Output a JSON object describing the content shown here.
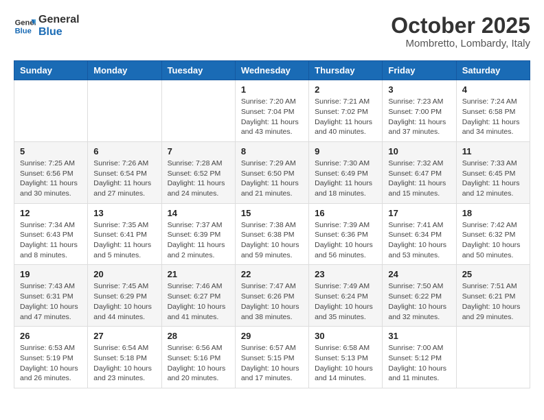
{
  "header": {
    "logo_line1": "General",
    "logo_line2": "Blue",
    "month": "October 2025",
    "location": "Mombretto, Lombardy, Italy"
  },
  "weekdays": [
    "Sunday",
    "Monday",
    "Tuesday",
    "Wednesday",
    "Thursday",
    "Friday",
    "Saturday"
  ],
  "weeks": [
    [
      {
        "day": "",
        "info": ""
      },
      {
        "day": "",
        "info": ""
      },
      {
        "day": "",
        "info": ""
      },
      {
        "day": "1",
        "info": "Sunrise: 7:20 AM\nSunset: 7:04 PM\nDaylight: 11 hours\nand 43 minutes."
      },
      {
        "day": "2",
        "info": "Sunrise: 7:21 AM\nSunset: 7:02 PM\nDaylight: 11 hours\nand 40 minutes."
      },
      {
        "day": "3",
        "info": "Sunrise: 7:23 AM\nSunset: 7:00 PM\nDaylight: 11 hours\nand 37 minutes."
      },
      {
        "day": "4",
        "info": "Sunrise: 7:24 AM\nSunset: 6:58 PM\nDaylight: 11 hours\nand 34 minutes."
      }
    ],
    [
      {
        "day": "5",
        "info": "Sunrise: 7:25 AM\nSunset: 6:56 PM\nDaylight: 11 hours\nand 30 minutes."
      },
      {
        "day": "6",
        "info": "Sunrise: 7:26 AM\nSunset: 6:54 PM\nDaylight: 11 hours\nand 27 minutes."
      },
      {
        "day": "7",
        "info": "Sunrise: 7:28 AM\nSunset: 6:52 PM\nDaylight: 11 hours\nand 24 minutes."
      },
      {
        "day": "8",
        "info": "Sunrise: 7:29 AM\nSunset: 6:50 PM\nDaylight: 11 hours\nand 21 minutes."
      },
      {
        "day": "9",
        "info": "Sunrise: 7:30 AM\nSunset: 6:49 PM\nDaylight: 11 hours\nand 18 minutes."
      },
      {
        "day": "10",
        "info": "Sunrise: 7:32 AM\nSunset: 6:47 PM\nDaylight: 11 hours\nand 15 minutes."
      },
      {
        "day": "11",
        "info": "Sunrise: 7:33 AM\nSunset: 6:45 PM\nDaylight: 11 hours\nand 12 minutes."
      }
    ],
    [
      {
        "day": "12",
        "info": "Sunrise: 7:34 AM\nSunset: 6:43 PM\nDaylight: 11 hours\nand 8 minutes."
      },
      {
        "day": "13",
        "info": "Sunrise: 7:35 AM\nSunset: 6:41 PM\nDaylight: 11 hours\nand 5 minutes."
      },
      {
        "day": "14",
        "info": "Sunrise: 7:37 AM\nSunset: 6:39 PM\nDaylight: 11 hours\nand 2 minutes."
      },
      {
        "day": "15",
        "info": "Sunrise: 7:38 AM\nSunset: 6:38 PM\nDaylight: 10 hours\nand 59 minutes."
      },
      {
        "day": "16",
        "info": "Sunrise: 7:39 AM\nSunset: 6:36 PM\nDaylight: 10 hours\nand 56 minutes."
      },
      {
        "day": "17",
        "info": "Sunrise: 7:41 AM\nSunset: 6:34 PM\nDaylight: 10 hours\nand 53 minutes."
      },
      {
        "day": "18",
        "info": "Sunrise: 7:42 AM\nSunset: 6:32 PM\nDaylight: 10 hours\nand 50 minutes."
      }
    ],
    [
      {
        "day": "19",
        "info": "Sunrise: 7:43 AM\nSunset: 6:31 PM\nDaylight: 10 hours\nand 47 minutes."
      },
      {
        "day": "20",
        "info": "Sunrise: 7:45 AM\nSunset: 6:29 PM\nDaylight: 10 hours\nand 44 minutes."
      },
      {
        "day": "21",
        "info": "Sunrise: 7:46 AM\nSunset: 6:27 PM\nDaylight: 10 hours\nand 41 minutes."
      },
      {
        "day": "22",
        "info": "Sunrise: 7:47 AM\nSunset: 6:26 PM\nDaylight: 10 hours\nand 38 minutes."
      },
      {
        "day": "23",
        "info": "Sunrise: 7:49 AM\nSunset: 6:24 PM\nDaylight: 10 hours\nand 35 minutes."
      },
      {
        "day": "24",
        "info": "Sunrise: 7:50 AM\nSunset: 6:22 PM\nDaylight: 10 hours\nand 32 minutes."
      },
      {
        "day": "25",
        "info": "Sunrise: 7:51 AM\nSunset: 6:21 PM\nDaylight: 10 hours\nand 29 minutes."
      }
    ],
    [
      {
        "day": "26",
        "info": "Sunrise: 6:53 AM\nSunset: 5:19 PM\nDaylight: 10 hours\nand 26 minutes."
      },
      {
        "day": "27",
        "info": "Sunrise: 6:54 AM\nSunset: 5:18 PM\nDaylight: 10 hours\nand 23 minutes."
      },
      {
        "day": "28",
        "info": "Sunrise: 6:56 AM\nSunset: 5:16 PM\nDaylight: 10 hours\nand 20 minutes."
      },
      {
        "day": "29",
        "info": "Sunrise: 6:57 AM\nSunset: 5:15 PM\nDaylight: 10 hours\nand 17 minutes."
      },
      {
        "day": "30",
        "info": "Sunrise: 6:58 AM\nSunset: 5:13 PM\nDaylight: 10 hours\nand 14 minutes."
      },
      {
        "day": "31",
        "info": "Sunrise: 7:00 AM\nSunset: 5:12 PM\nDaylight: 10 hours\nand 11 minutes."
      },
      {
        "day": "",
        "info": ""
      }
    ]
  ]
}
